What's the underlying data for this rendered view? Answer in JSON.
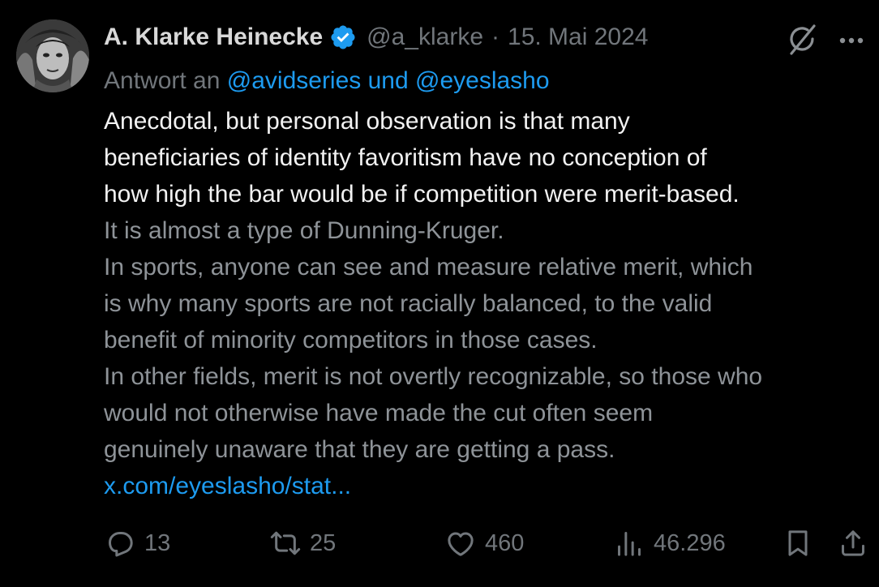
{
  "author": {
    "name": "A. Klarke Heinecke",
    "handle": "@a_klarke",
    "separator": "·",
    "date": "15. Mai 2024",
    "verified": true,
    "verified_color": "#1d9bf0"
  },
  "reply": {
    "prefix": "Antwort an",
    "mentions": "@avidseries und @eyeslasho"
  },
  "tweet": {
    "lines": [
      "Anecdotal, but personal observation is that many",
      "beneficiaries of identity favoritism have no conception of",
      "how high the bar would be if competition were merit-based.",
      "It is almost a type of Dunning-Kruger.",
      "In sports, anyone can see and measure relative merit, which",
      "is why many sports are not racially balanced, to the valid",
      "benefit of minority competitors in those cases.",
      "In other fields, merit is not overtly recognizable, so those who",
      "would not otherwise have made the cut often seem",
      "genuinely unaware that they are getting a pass."
    ],
    "link": "x.com/eyeslasho/stat..."
  },
  "actions": {
    "replies": "13",
    "reposts": "25",
    "likes": "460",
    "views": "46.296"
  },
  "icons": {
    "header": [
      "grok-icon",
      "more-icon"
    ],
    "actions": [
      "reply-icon",
      "repost-icon",
      "like-icon",
      "views-icon",
      "bookmark-icon",
      "share-icon"
    ]
  },
  "colors": {
    "background": "#000000",
    "accent": "#1d9bf0",
    "secondary_text": "#71767b"
  }
}
